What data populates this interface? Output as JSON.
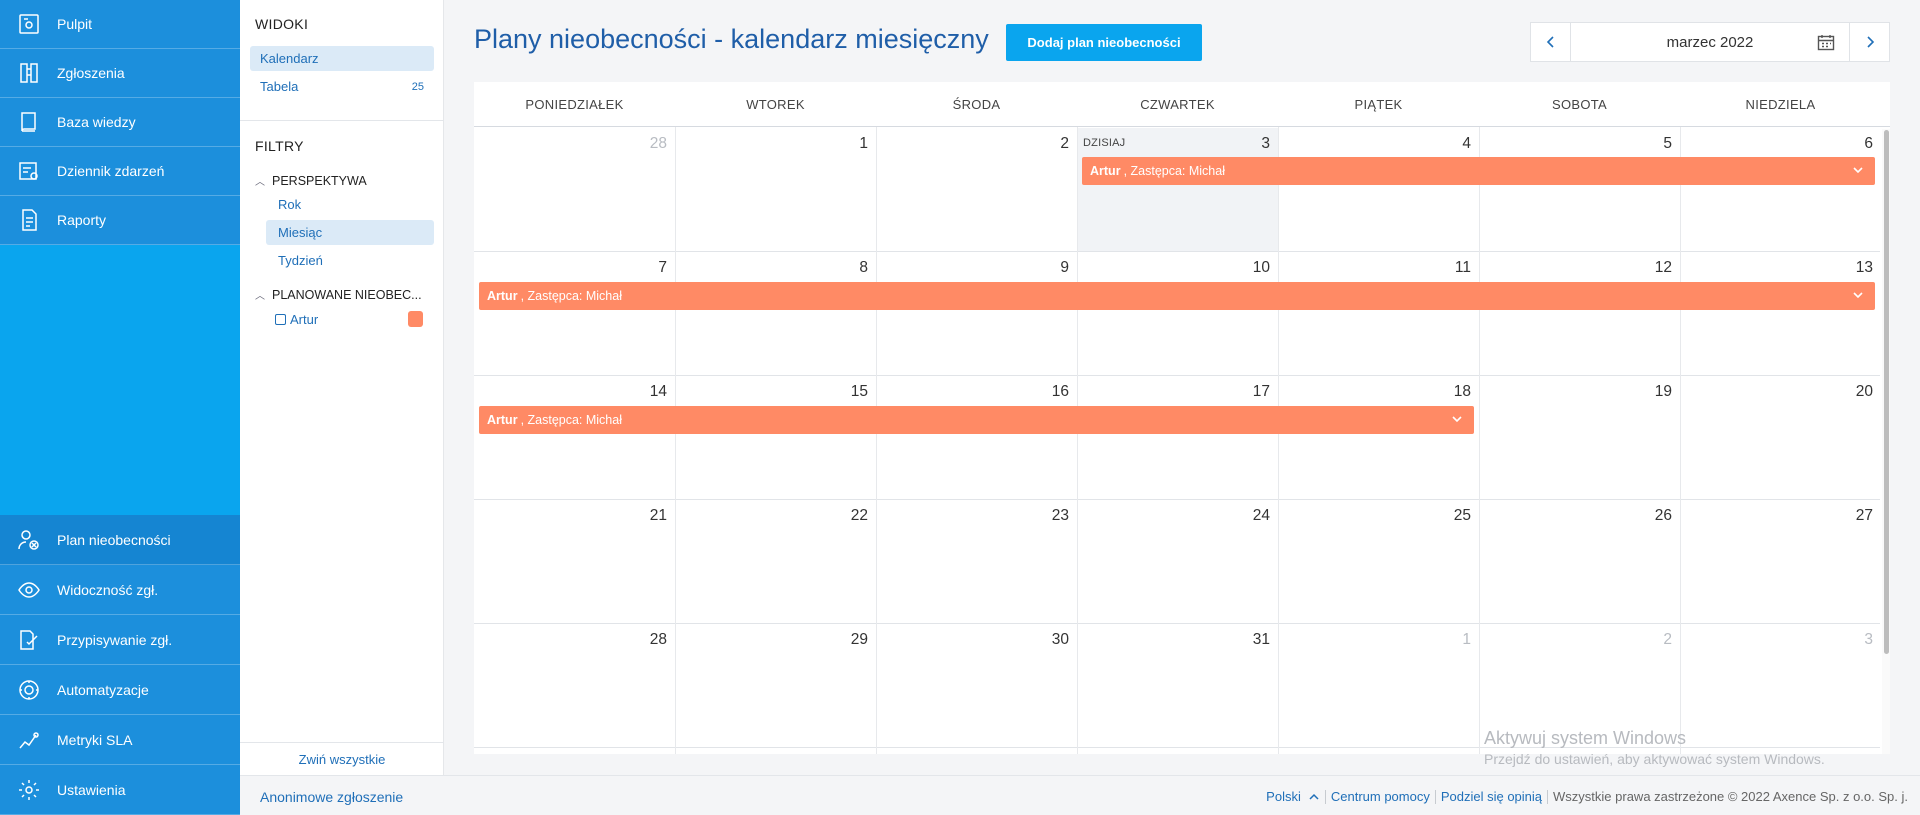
{
  "sidebar": {
    "top_items": [
      {
        "label": "Pulpit",
        "icon": "dashboard-icon"
      },
      {
        "label": "Zgłoszenia",
        "icon": "tickets-icon"
      },
      {
        "label": "Baza wiedzy",
        "icon": "knowledge-base-icon"
      },
      {
        "label": "Dziennik zdarzeń",
        "icon": "event-log-icon"
      },
      {
        "label": "Raporty",
        "icon": "reports-icon"
      }
    ],
    "bottom_items": [
      {
        "label": "Plan nieobecności",
        "icon": "absence-plan-icon",
        "active": true
      },
      {
        "label": "Widoczność zgł.",
        "icon": "visibility-icon"
      },
      {
        "label": "Przypisywanie zgł.",
        "icon": "assignment-icon"
      },
      {
        "label": "Automatyzacje",
        "icon": "automation-icon"
      },
      {
        "label": "Metryki SLA",
        "icon": "sla-metrics-icon"
      },
      {
        "label": "Ustawienia",
        "icon": "settings-icon"
      }
    ]
  },
  "panel": {
    "views_heading": "WIDOKI",
    "views": [
      {
        "label": "Kalendarz",
        "selected": true
      },
      {
        "label": "Tabela",
        "count": "25"
      }
    ],
    "filters_heading": "FILTRY",
    "perspective_heading": "PERSPEKTYWA",
    "perspective_options": [
      {
        "label": "Rok"
      },
      {
        "label": "Miesiąc",
        "selected": true
      },
      {
        "label": "Tydzień"
      }
    ],
    "planned_heading": "PLANOWANE NIEOBEC...",
    "planned_items": [
      {
        "label": "Artur",
        "checked": false,
        "color": "#ff8a65"
      }
    ],
    "collapse_all": "Zwiń wszystkie"
  },
  "header": {
    "title": "Plany nieobecności - kalendarz miesięczny",
    "add_button": "Dodaj plan nieobecności",
    "month_label": "marzec 2022"
  },
  "calendar": {
    "weekdays": [
      "PONIEDZIAŁEK",
      "WTOREK",
      "ŚRODA",
      "CZWARTEK",
      "PIĄTEK",
      "SOBOTA",
      "NIEDZIELA"
    ],
    "today_label": "DZISIAJ",
    "weeks": [
      [
        "28",
        "1",
        "2",
        "3",
        "4",
        "5",
        "6"
      ],
      [
        "7",
        "8",
        "9",
        "10",
        "11",
        "12",
        "13"
      ],
      [
        "14",
        "15",
        "16",
        "17",
        "18",
        "19",
        "20"
      ],
      [
        "21",
        "22",
        "23",
        "24",
        "25",
        "26",
        "27"
      ],
      [
        "28",
        "29",
        "30",
        "31",
        "1",
        "2",
        "3"
      ]
    ],
    "events": [
      {
        "person": "Artur",
        "text": ", Zastępca: Michał"
      },
      {
        "person": "Artur",
        "text": ", Zastępca: Michał"
      },
      {
        "person": "Artur",
        "text": ", Zastępca: Michał"
      }
    ]
  },
  "watermark": {
    "line1": "Aktywuj system Windows",
    "line2": "Przejdź do ustawień, aby aktywować system Windows."
  },
  "footer": {
    "anonymous_report": "Anonimowe zgłoszenie",
    "language": "Polski",
    "help_center": "Centrum pomocy",
    "feedback": "Podziel się opinią",
    "copyright": "Wszystkie prawa zastrzeżone © 2022 Axence Sp. z o.o. Sp. j."
  },
  "colors": {
    "sidebar_bg": "#0aa5ee",
    "sidebar_item": "#1c8fdc",
    "accent": "#0aa5ee",
    "event": "#ff8a65",
    "title": "#1f5ea8"
  }
}
